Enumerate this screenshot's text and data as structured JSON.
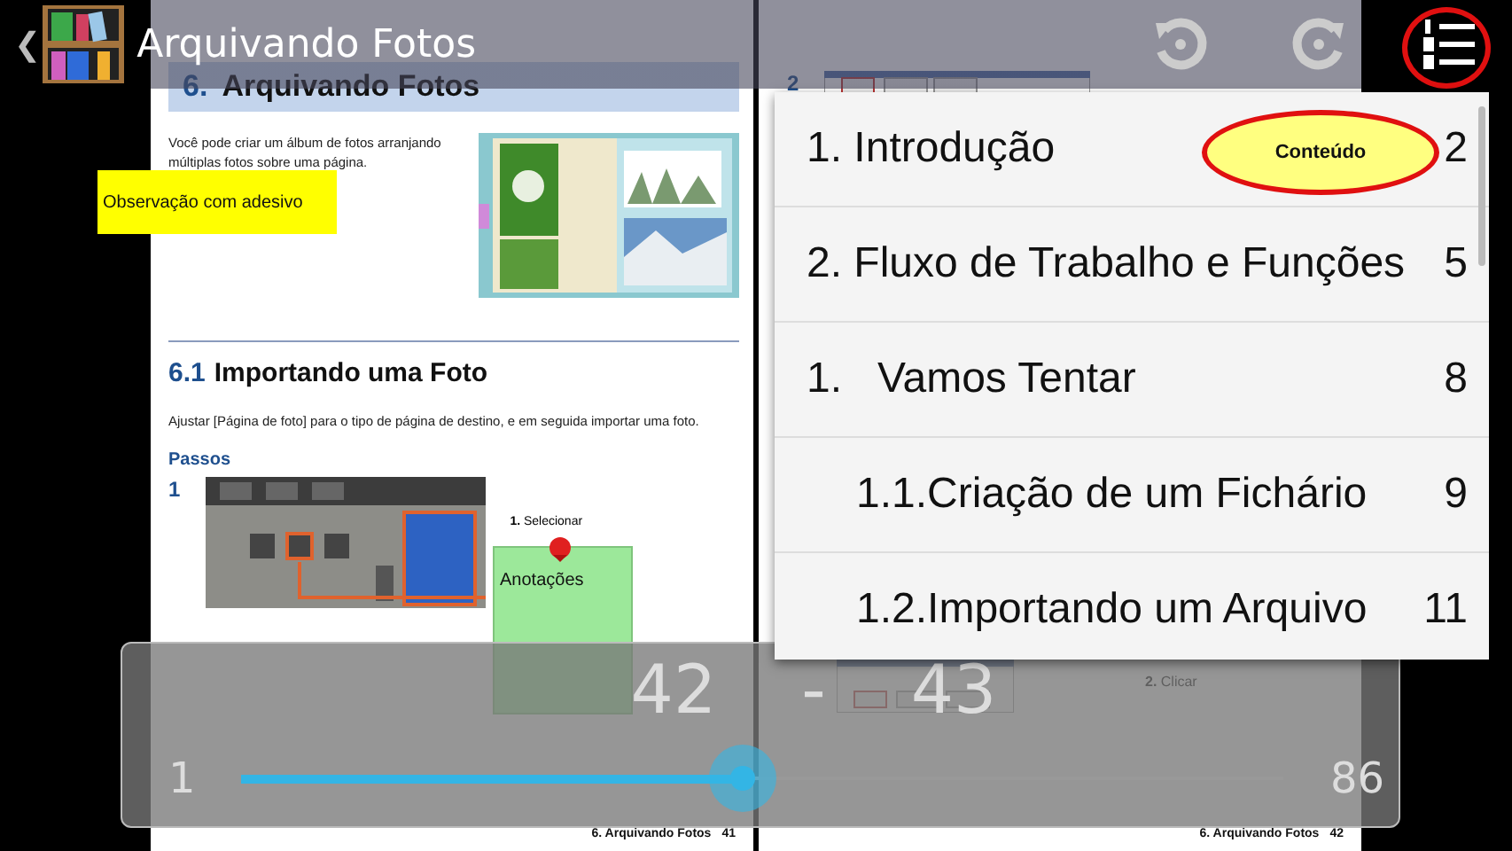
{
  "header": {
    "back": "❮",
    "title": "Arquivando Fotos"
  },
  "toolbar": {
    "toc_annotation": "Conteúdo"
  },
  "left_page": {
    "heading_number": "6.",
    "heading": "Arquivando Fotos",
    "intro": "Você pode criar um álbum de fotos arranjando múltiplas fotos sobre uma página.",
    "sticky_note": "Observação com adesivo",
    "section_number": "6.1",
    "section_title": "Importando uma Foto",
    "section_text": "Ajustar [Página de foto] para o tipo de página de destino, e em seguida importar uma foto.",
    "steps_heading": "Passos",
    "step_number": "1",
    "step_callout": "**1.** Selecionar",
    "note": "Anotações",
    "footer_chapter": "6. Arquivando Fotos",
    "footer_page": "41"
  },
  "right_page": {
    "step_number": "2",
    "step_callout": "**2.** Clicar",
    "footer_chapter": "6. Arquivando Fotos",
    "footer_page": "42"
  },
  "toc": {
    "items": [
      {
        "label": "1. Introdução",
        "page": "2"
      },
      {
        "label": "2. Fluxo de Trabalho e Funções",
        "page": "5"
      },
      {
        "label": "1.   Vamos Tentar",
        "page": "8",
        "children": [
          {
            "label": "1.1.Criação de um Fichário",
            "page": "9"
          },
          {
            "label": "1.2.Importando um Arquivo",
            "page": "11"
          }
        ]
      }
    ]
  },
  "pager": {
    "from": "42",
    "separator": "-",
    "to": "43",
    "min": "1",
    "max": "86",
    "level": 0.48
  }
}
